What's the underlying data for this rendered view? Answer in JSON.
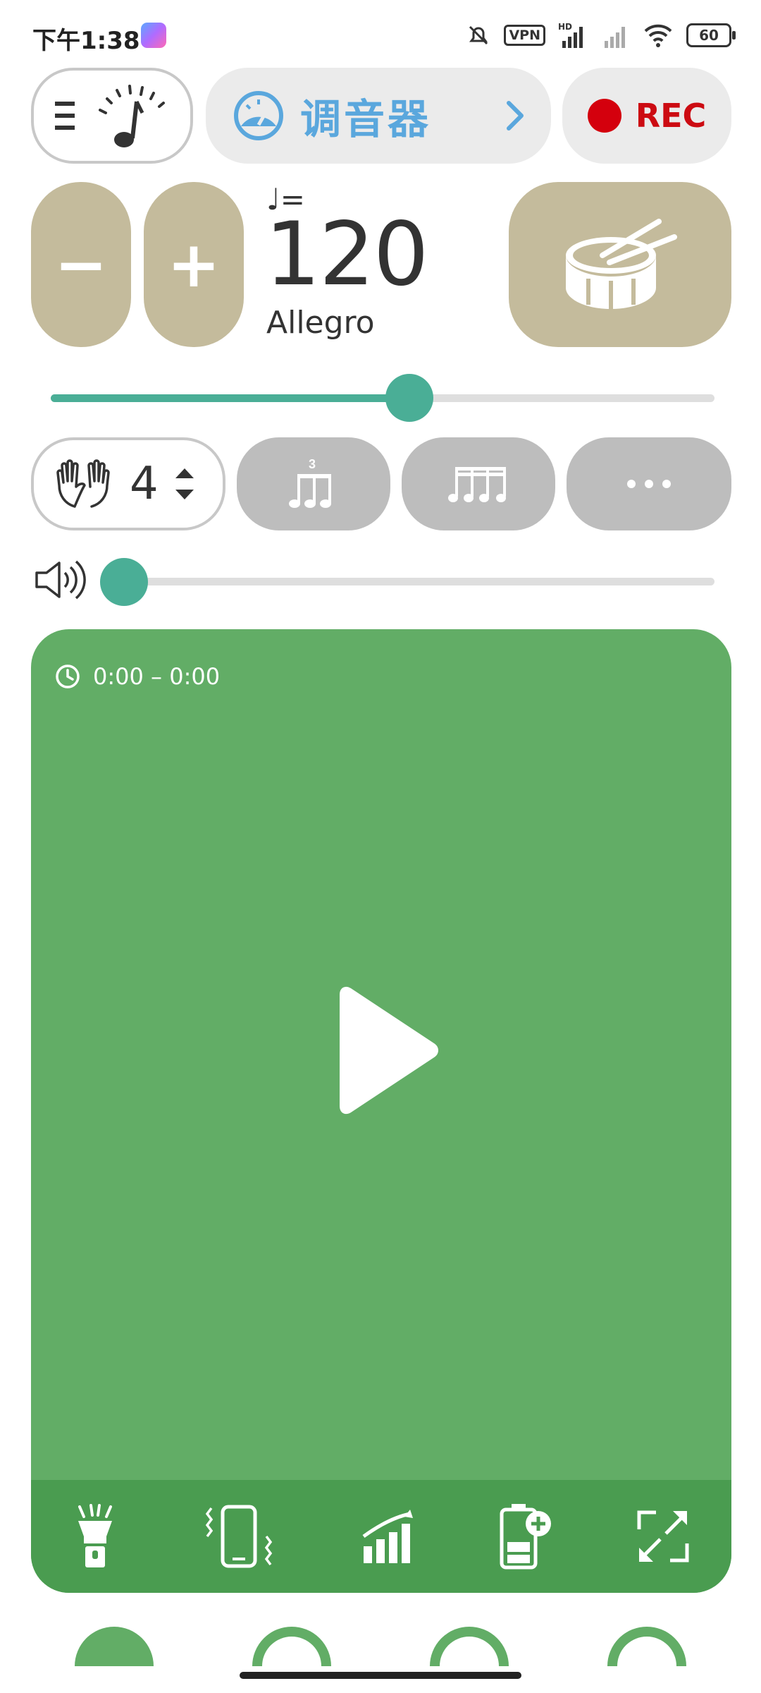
{
  "status_bar": {
    "time": "下午1:38",
    "vpn": "VPN",
    "hd": "HD",
    "battery": "60"
  },
  "header": {
    "tuner_label": "调音器",
    "rec_label": "REC"
  },
  "tempo": {
    "minus_label": "−",
    "plus_label": "+",
    "note_label": "♩=",
    "bpm": "120",
    "marking": "Allegro",
    "slider_fraction": 0.54
  },
  "beats": {
    "value": "4",
    "triplet_number": "3"
  },
  "volume": {
    "level_fraction": 0.0
  },
  "panel": {
    "time_range": "0:00 – 0:00"
  },
  "colors": {
    "accent": "#4aae96",
    "panel": "#62ad66",
    "panel_toolbar": "#4a9c50",
    "tan": "#c4bb9c",
    "rec": "#d4000d",
    "tuner_blue": "#5aa7dd"
  },
  "icons": {
    "toolbar": [
      "flashlight-icon",
      "vibrate-icon",
      "signal-ramp-icon",
      "battery-plus-icon",
      "fullscreen-icon"
    ],
    "tabs": [
      "tab-filled-arc-icon",
      "tab-arc-icon",
      "tab-arc-icon",
      "tab-arc-icon"
    ]
  }
}
